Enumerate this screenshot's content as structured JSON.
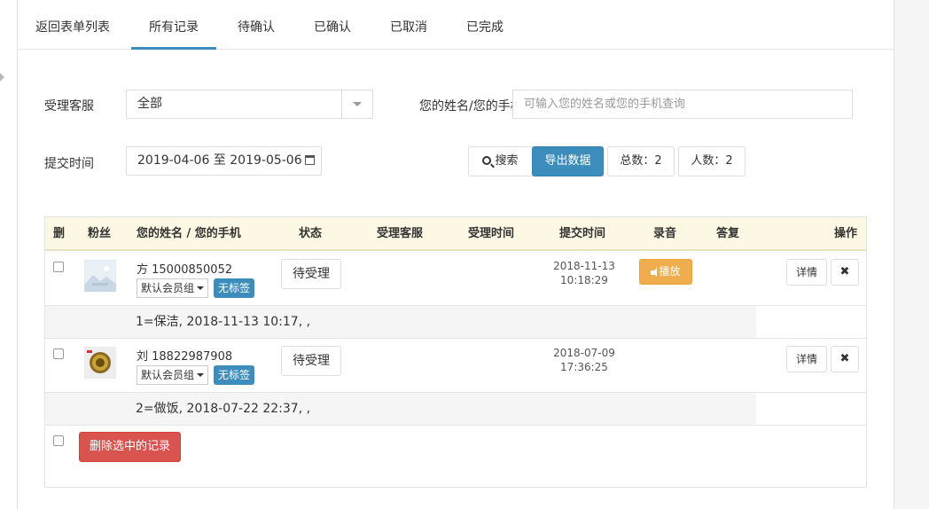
{
  "tabs": [
    {
      "label": "返回表单列表",
      "active": false
    },
    {
      "label": "所有记录",
      "active": true
    },
    {
      "label": "待确认",
      "active": false
    },
    {
      "label": "已确认",
      "active": false
    },
    {
      "label": "已取消",
      "active": false
    },
    {
      "label": "已完成",
      "active": false
    }
  ],
  "filters": {
    "agent_label": "受理客服",
    "agent_value": "全部",
    "name_phone_label": "您的姓名/您的手机",
    "name_phone_placeholder": "可输入您的姓名或您的手机查询",
    "date_label": "提交时间",
    "date_range": "2019-04-06 至 2019-05-06"
  },
  "toolbar": {
    "search_label": "搜索",
    "export_label": "导出数据",
    "total_label": "总数：2",
    "people_label": "人数：2"
  },
  "table": {
    "columns": [
      "删",
      "粉丝",
      "您的姓名 / 您的手机",
      "状态",
      "受理客服",
      "受理时间",
      "提交时间",
      "录音",
      "答复",
      "操作"
    ],
    "rows": [
      {
        "name_phone": "方 15000850052",
        "group": "默认会员组",
        "tag": "无标签",
        "status": "待受理",
        "submit_date": "2018-11-13",
        "submit_time": "10:18:29",
        "play_label": "播放",
        "detail_label": "详情",
        "close_glyph": "✖",
        "answer": "1=保洁, 2018-11-13 10:17, ,"
      },
      {
        "name_phone": "刘 18822987908",
        "group": "默认会员组",
        "tag": "无标签",
        "status": "待受理",
        "submit_date": "2018-07-09",
        "submit_time": "17:36:25",
        "detail_label": "详情",
        "close_glyph": "✖",
        "answer": "2=做饭, 2018-07-22 22:37, ,"
      }
    ],
    "delete_selected_label": "删除选中的记录"
  },
  "colors": {
    "primary": "#3c8dbc",
    "warning": "#f0ad4e",
    "danger": "#d9534f",
    "table_header_bg": "#fdf8e4"
  }
}
